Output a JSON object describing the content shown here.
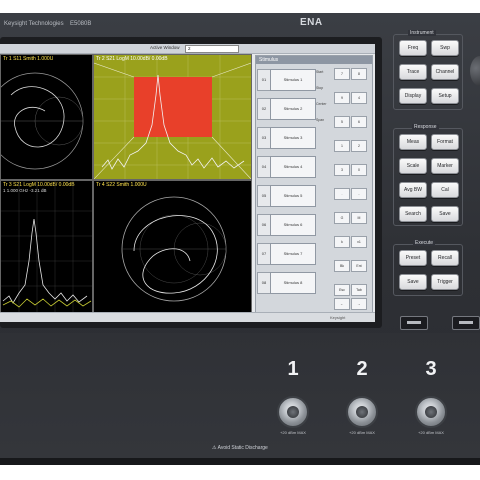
{
  "instrument": {
    "brand_line": "Keysight Technologies",
    "model_line": "E5080B",
    "logo": "ENA"
  },
  "screen": {
    "toolbar": {
      "active_window_label": "Active Window",
      "active_window_value": "2"
    },
    "traces": [
      {
        "id": 1,
        "title": "Tr 1  S11  Smith  1.000U",
        "subtitle": ""
      },
      {
        "id": 2,
        "title": "Tr 2  S21  LogM  10.00dB/  0.00dB",
        "subtitle": ""
      },
      {
        "id": 3,
        "title": "Tr 3  S21  LogM  10.00dB/  0.00dB",
        "subtitle": "1  1.000 GHz  -3.21 dB"
      },
      {
        "id": 4,
        "title": "Tr 4  S22  Smith  1.000U",
        "subtitle": ""
      }
    ],
    "softkey_panel": {
      "header": "Stimulus",
      "rows": [
        "Stimulus 1",
        "Stimulus 2",
        "Stimulus 3",
        "Stimulus 4",
        "Stimulus 5",
        "Stimulus 6",
        "Stimulus 7",
        "Stimulus 8"
      ],
      "row_numbers": [
        "01",
        "02",
        "03",
        "04",
        "05",
        "06",
        "07",
        "08"
      ],
      "side_notes": [
        "Start",
        "Stop",
        "Center",
        "Span"
      ],
      "mini_keys": [
        "7",
        "8",
        "9",
        "4",
        "5",
        "6",
        "1",
        "2",
        "3",
        "0",
        ".",
        "-",
        "G",
        "M",
        "k",
        "x1",
        "Bk",
        "Ent",
        "Esc",
        "Tab",
        "←",
        "→"
      ]
    },
    "status": "Keysight"
  },
  "hardkeys": {
    "groups": [
      {
        "title": "Instrument",
        "keys": [
          "Freq",
          "Swp",
          "Trace",
          "Channel",
          "Display",
          "Setup"
        ]
      },
      {
        "title": "Response",
        "keys": [
          "Meas",
          "Format",
          "Scale",
          "Marker",
          "Avg BW",
          "Cal",
          "Search",
          "Save"
        ]
      },
      {
        "title": "Execute",
        "keys": [
          "Preset",
          "Recall",
          "Save",
          "Trigger"
        ]
      }
    ]
  },
  "ports": [
    {
      "label": "1",
      "warning": "+20 dBm MAX"
    },
    {
      "label": "2",
      "warning": "+20 dBm MAX"
    },
    {
      "label": "3",
      "warning": "+20 dBm MAX"
    }
  ],
  "rf_warning": "⚠ Avoid Static Discharge"
}
